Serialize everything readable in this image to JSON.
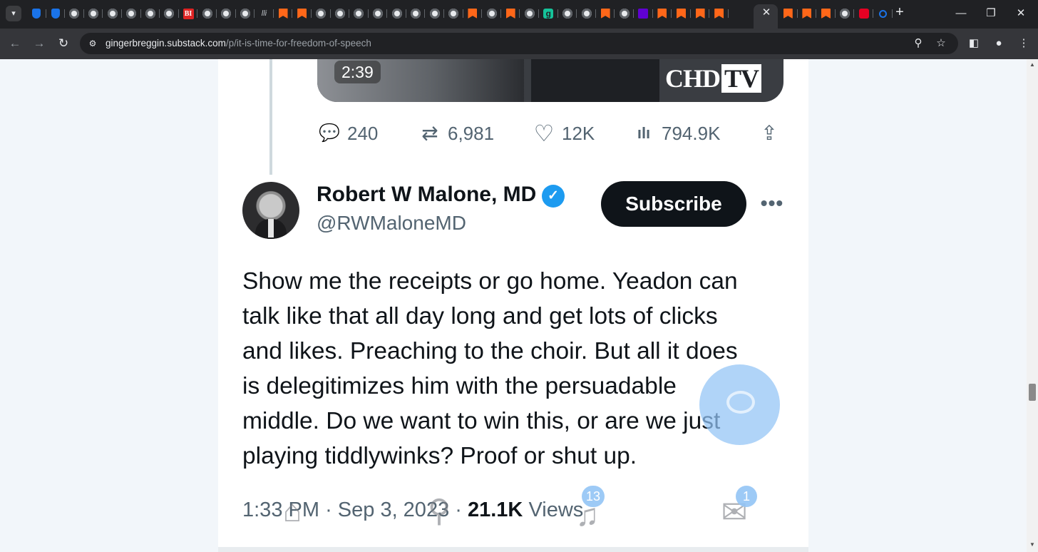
{
  "browser": {
    "tab_menu_icon": "chevron-down-icon",
    "tabs": [
      {
        "icon": "shield"
      },
      {
        "icon": "shield"
      },
      {
        "icon": "globe"
      },
      {
        "icon": "globe"
      },
      {
        "icon": "globe"
      },
      {
        "icon": "globe"
      },
      {
        "icon": "globe"
      },
      {
        "icon": "globe"
      },
      {
        "icon": "bi",
        "glyph": "BI"
      },
      {
        "icon": "globe"
      },
      {
        "icon": "globe"
      },
      {
        "icon": "globe"
      },
      {
        "icon": "text",
        "glyph": "lli"
      },
      {
        "icon": "bookmark"
      },
      {
        "icon": "bookmark"
      },
      {
        "icon": "globe"
      },
      {
        "icon": "globe"
      },
      {
        "icon": "globe"
      },
      {
        "icon": "globe"
      },
      {
        "icon": "globe"
      },
      {
        "icon": "globe"
      },
      {
        "icon": "globe"
      },
      {
        "icon": "globe"
      },
      {
        "icon": "bookmark"
      },
      {
        "icon": "globe"
      },
      {
        "icon": "bookmark"
      },
      {
        "icon": "globe"
      },
      {
        "icon": "g",
        "glyph": "g"
      },
      {
        "icon": "globe"
      },
      {
        "icon": "globe"
      },
      {
        "icon": "bookmark"
      },
      {
        "icon": "globe"
      },
      {
        "icon": "mail"
      },
      {
        "icon": "bookmark"
      },
      {
        "icon": "bookmark"
      },
      {
        "icon": "bookmark"
      },
      {
        "icon": "bookmark"
      }
    ],
    "tabs_after_active": [
      {
        "icon": "bookmark"
      },
      {
        "icon": "bookmark"
      },
      {
        "icon": "bookmark"
      },
      {
        "icon": "globe"
      },
      {
        "icon": "red"
      },
      {
        "icon": "search"
      }
    ],
    "active_tab_close": "✕",
    "new_tab": "+",
    "window_controls": {
      "minimize": "—",
      "restore": "❐",
      "close": "✕"
    },
    "nav": {
      "back": "←",
      "forward": "→",
      "reload": "↻"
    },
    "site_info_icon": "⚙",
    "url_host": "gingerbreggin.substack.com",
    "url_path": "/p/it-is-time-for-freedom-of-speech",
    "omnibox_icons": {
      "zoom": "⚲",
      "bookmark_star": "☆"
    },
    "toolbar_icons": {
      "side_panel": "◧",
      "profile": "●",
      "menu": "⋮"
    },
    "scroll_arrows": {
      "up": "▲",
      "down": "▼"
    }
  },
  "video": {
    "duration": "2:39",
    "brand_main": "CHD",
    "brand_tv": "TV"
  },
  "prev_tweet_metrics": {
    "replies": "240",
    "reposts": "6,981",
    "likes": "12K",
    "views": "794.9K",
    "icons": {
      "reply": "comment-icon",
      "repost": "repost-icon",
      "like": "heart-icon",
      "views": "bar-chart-icon",
      "share": "share-icon"
    },
    "glyphs": {
      "reply": "💬",
      "repost": "⇄",
      "like": "♡",
      "views": "ılı",
      "share": "⇪"
    }
  },
  "tweet": {
    "author_name": "Robert W Malone, MD",
    "verified_glyph": "✓",
    "handle": "@RWMaloneMD",
    "subscribe_label": "Subscribe",
    "more_glyph": "•••",
    "text_lines": [
      "Show me the receipts or go home.  Yeadon can",
      "talk like that all day long and get lots of clicks",
      "and likes.  Preaching to the choir.  But all it does",
      "is delegitimizes him with the persuadable",
      "middle.  Do we want to win this, or are we just",
      "playing tiddlywinks?  Proof or shut up."
    ],
    "time": "1:33 PM",
    "date": "Sep 3, 2023",
    "views_count": "21.1K",
    "views_label": "Views"
  },
  "overlay_nav": {
    "home_glyph": "⌂",
    "search_glyph": "⚲",
    "notifications_glyph": "♫",
    "notifications_badge": "13",
    "messages_glyph": "✉",
    "messages_badge": "1"
  },
  "colors": {
    "accent_verified": "#1d9bf0",
    "text_primary": "#0f1419",
    "text_secondary": "#536471",
    "fab": "#92c4f5",
    "substack_orange": "#ff6719"
  }
}
